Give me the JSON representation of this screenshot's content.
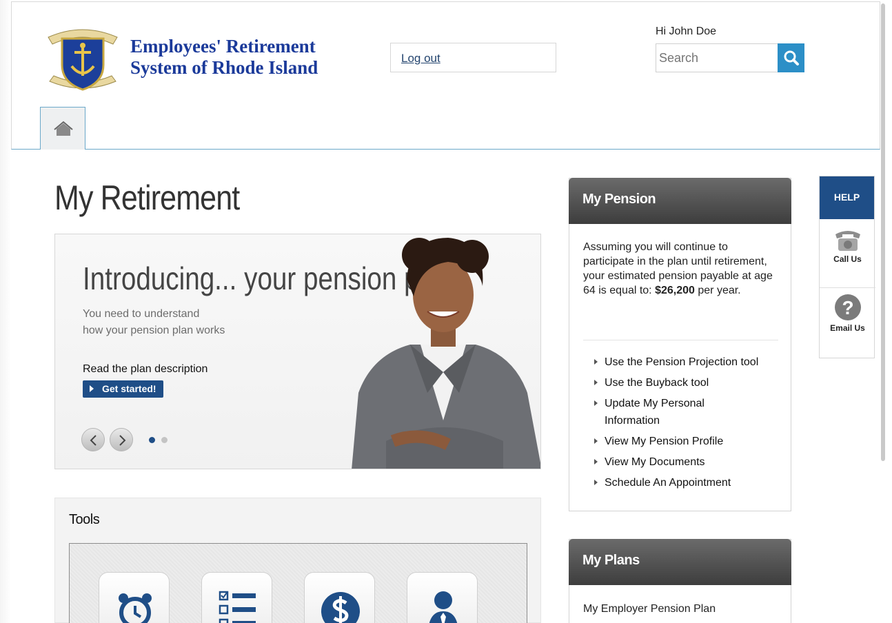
{
  "header": {
    "org_name_line1": "Employees' Retirement",
    "org_name_line2": "System of Rhode Island",
    "seal_text_top": "STATE OF RHODE ISLAND",
    "seal_text_bottom": "HOPE",
    "logout_label": "Log out",
    "greeting": "Hi John Doe",
    "search_placeholder": "Search"
  },
  "nav": {
    "home_icon": "home-icon"
  },
  "main": {
    "page_title": "My Retirement",
    "banner": {
      "heading": "Introducing... your pension plan",
      "sub_line1": "You need to understand",
      "sub_line2": "how your pension plan works",
      "read_text": "Read the plan description",
      "cta_label": "Get started!",
      "slide_count": 2,
      "active_slide": 1
    },
    "tools": {
      "title": "Tools",
      "icons": [
        "alarm-clock-icon",
        "checklist-icon",
        "dollar-icon",
        "person-icon"
      ]
    }
  },
  "pension_panel": {
    "title": "My Pension",
    "text_prefix": "Assuming you will continue to participate in the plan until retirement, your estimated pension payable at age 64 is equal to:",
    "amount": "$26,200",
    "amount_suffix": " per year.",
    "links": [
      "Use the Pension Projection tool",
      "Use the Buyback tool",
      "Update My Personal Information",
      "View My Pension Profile",
      "View My Documents",
      "Schedule An Appointment"
    ]
  },
  "plans_panel": {
    "title": "My Plans",
    "item": "My Employer Pension Plan"
  },
  "help": {
    "title": "HELP",
    "call_label": "Call Us",
    "email_label": "Email Us"
  },
  "colors": {
    "brand_blue": "#1f4e87",
    "search_blue": "#2c8fc7",
    "logo_text": "#1b3a9a"
  }
}
